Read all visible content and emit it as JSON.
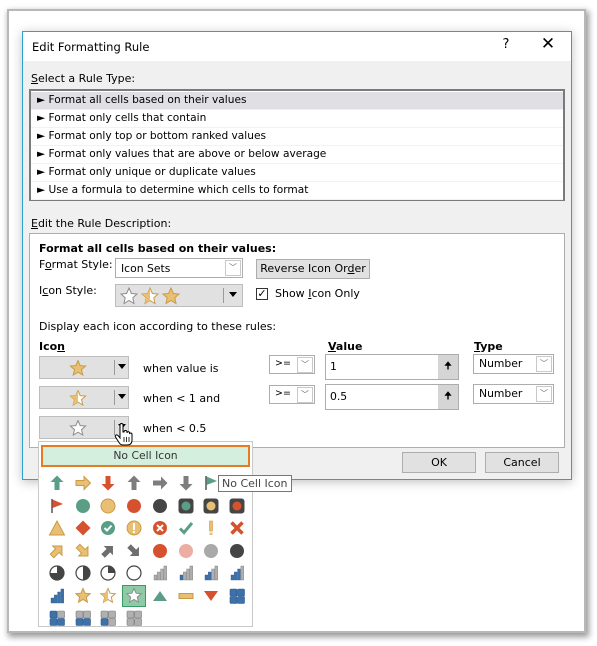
{
  "dialog": {
    "title": "Edit Formatting Rule",
    "help_label": "?",
    "close_label": "✕",
    "accent_color": "#2aa3c8"
  },
  "rule_type": {
    "label_prefix": "S",
    "label_rest": "elect a Rule Type:",
    "items": [
      {
        "label": "► Format all cells based on their values",
        "selected": true
      },
      {
        "label": "► Format only cells that contain",
        "selected": false
      },
      {
        "label": "► Format only top or bottom ranked values",
        "selected": false
      },
      {
        "label": "► Format only values that are above or below average",
        "selected": false
      },
      {
        "label": "► Format only unique or duplicate values",
        "selected": false
      },
      {
        "label": "► Use a formula to determine which cells to format",
        "selected": false
      }
    ]
  },
  "description": {
    "label_prefix": "E",
    "label_rest": "dit the Rule Description:",
    "heading": "Format all cells based on their values:",
    "format_style_label_a": "F",
    "format_style_label_u": "o",
    "format_style_label_b": "rmat Style:",
    "format_style_value": "Icon Sets",
    "reverse_button_a": "Reverse Icon Or",
    "reverse_button_u": "d",
    "reverse_button_b": "er",
    "icon_style_label_a": "I",
    "icon_style_label_u": "c",
    "icon_style_label_b": "on Style:",
    "icon_style_value": "3 Stars",
    "show_icon_only_a": "Show ",
    "show_icon_only_u": "I",
    "show_icon_only_b": "con Only",
    "show_icon_only_checked": true,
    "rules_intro": "Display each icon according to these rules:",
    "col_icon_a": "Ico",
    "col_icon_u": "n",
    "col_value_u": "V",
    "col_value_b": "alue",
    "col_type_u": "T",
    "col_type_b": "ype",
    "rules": [
      {
        "icon": "star-full",
        "condition": "when value is",
        "operator": ">=",
        "value": "1",
        "type": "Number"
      },
      {
        "icon": "star-half",
        "condition": "when < 1 and",
        "operator": ">=",
        "value": "0.5",
        "type": "Number"
      },
      {
        "icon": "star-empty",
        "condition": "when < 0.5"
      }
    ]
  },
  "buttons": {
    "ok": "OK",
    "cancel": "Cancel"
  },
  "icon_picker": {
    "no_icon_label": "No Cell Icon",
    "tooltip": "No Cell Icon",
    "selected_index": 35,
    "icons": [
      "arrow-up-green",
      "arrow-right-yellow",
      "arrow-down-red",
      "arrow-up-gray",
      "arrow-right-gray",
      "arrow-down-gray",
      "flag-green",
      "flag-yellow",
      "flag-red",
      "circle-green",
      "circle-yellow",
      "circle-red",
      "circle-black",
      "traffic-light-green",
      "traffic-light-yellow",
      "traffic-light-red",
      "triangle-yellow",
      "diamond-red",
      "check-circle-green",
      "exclaim-circle-yellow",
      "x-circle-red",
      "check-green",
      "exclaim-yellow",
      "x-red",
      "arrow-upright-yellow",
      "arrow-downright-yellow",
      "arrow-upright-gray",
      "arrow-downright-gray",
      "circle-red-2",
      "circle-pink",
      "circle-gray",
      "circle-black-2",
      "quarter-3",
      "quarter-2",
      "quarter-1",
      "quarter-0",
      "bars-1",
      "bars-2",
      "bars-3",
      "bars-4",
      "bars-5",
      "star-full",
      "star-half",
      "star-empty",
      "triangle-up-green",
      "dash-yellow",
      "triangle-down-red",
      "boxes-4",
      "boxes-3",
      "boxes-2",
      "boxes-1",
      "boxes-0"
    ]
  },
  "colors": {
    "green": "#5b9e86",
    "yellow": "#e8bf73",
    "red": "#d6512e",
    "gray": "#7d7d7d",
    "black": "#454545",
    "blue": "#3e70aa",
    "highlight_orange": "#e87a1f"
  }
}
